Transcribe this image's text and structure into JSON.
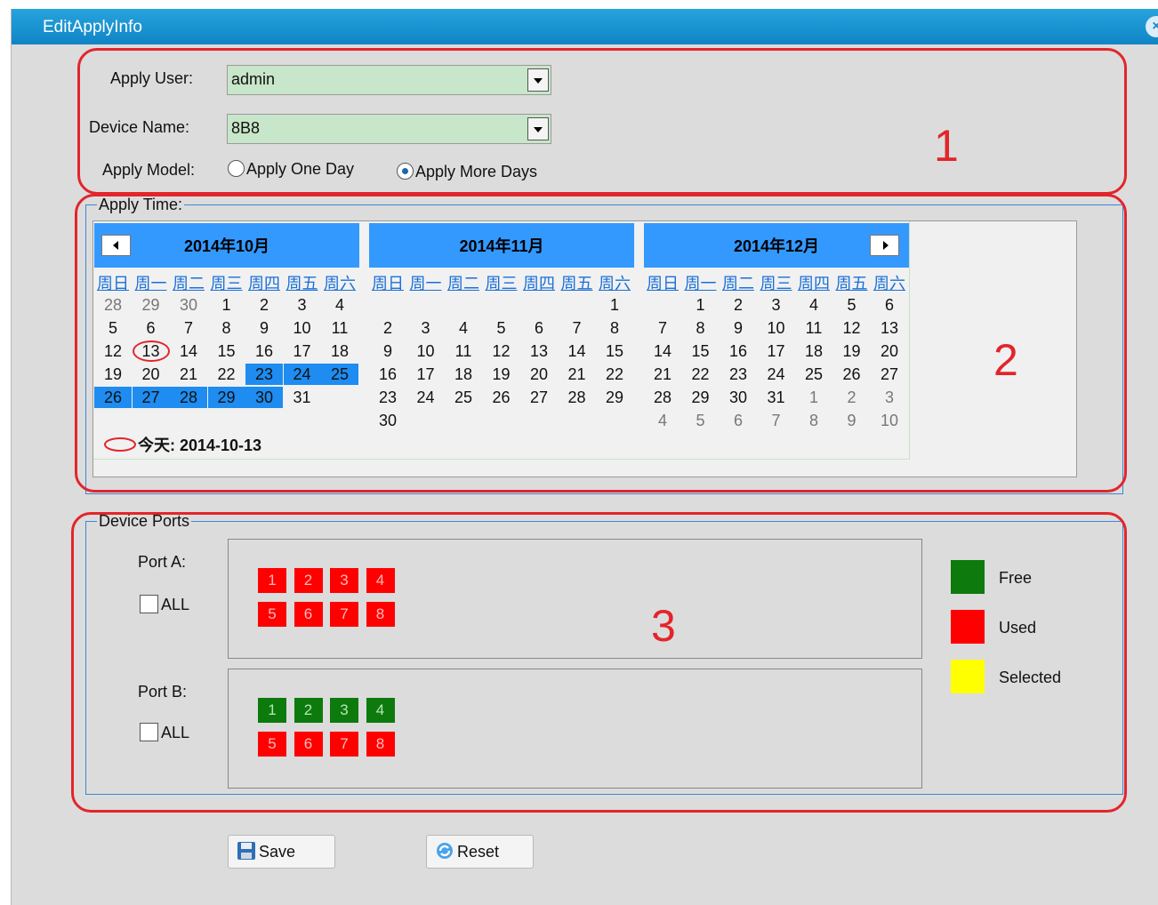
{
  "window": {
    "title": "EditApplyInfo",
    "close_glyph": "×"
  },
  "form": {
    "apply_user_label": "Apply User:",
    "apply_user_value": "admin",
    "device_name_label": "Device Name:",
    "device_name_value": "8B8",
    "apply_model_label": "Apply Model:",
    "options": [
      {
        "label": "Apply One Day",
        "selected": false
      },
      {
        "label": "Apply More Days",
        "selected": true
      }
    ]
  },
  "apply_time": {
    "legend": "Apply Time:",
    "weekdays": [
      "周日",
      "周一",
      "周二",
      "周三",
      "周四",
      "周五",
      "周六"
    ],
    "months": [
      {
        "title": "2014年10月",
        "rows": [
          [
            "28",
            "29",
            "30",
            "1",
            "2",
            "3",
            "4"
          ],
          [
            "5",
            "6",
            "7",
            "8",
            "9",
            "10",
            "11"
          ],
          [
            "12",
            "13",
            "14",
            "15",
            "16",
            "17",
            "18"
          ],
          [
            "19",
            "20",
            "21",
            "22",
            "23",
            "24",
            "25"
          ],
          [
            "26",
            "27",
            "28",
            "29",
            "30",
            "31",
            ""
          ],
          [
            "",
            "",
            "",
            "",
            "",
            "",
            ""
          ]
        ],
        "other_month": [
          [
            0,
            0
          ],
          [
            0,
            1
          ],
          [
            0,
            2
          ]
        ],
        "selected": [
          [
            3,
            4
          ],
          [
            3,
            5
          ],
          [
            3,
            6
          ],
          [
            4,
            0
          ],
          [
            4,
            1
          ],
          [
            4,
            2
          ],
          [
            4,
            3
          ],
          [
            4,
            4
          ]
        ],
        "today": [
          2,
          1
        ]
      },
      {
        "title": "2014年11月",
        "rows": [
          [
            "",
            "",
            "",
            "",
            "",
            "",
            "1"
          ],
          [
            "2",
            "3",
            "4",
            "5",
            "6",
            "7",
            "8"
          ],
          [
            "9",
            "10",
            "11",
            "12",
            "13",
            "14",
            "15"
          ],
          [
            "16",
            "17",
            "18",
            "19",
            "20",
            "21",
            "22"
          ],
          [
            "23",
            "24",
            "25",
            "26",
            "27",
            "28",
            "29"
          ],
          [
            "30",
            "",
            "",
            "",
            "",
            "",
            ""
          ]
        ],
        "other_month": [],
        "selected": []
      },
      {
        "title": "2014年12月",
        "rows": [
          [
            "",
            "1",
            "2",
            "3",
            "4",
            "5",
            "6"
          ],
          [
            "7",
            "8",
            "9",
            "10",
            "11",
            "12",
            "13"
          ],
          [
            "14",
            "15",
            "16",
            "17",
            "18",
            "19",
            "20"
          ],
          [
            "21",
            "22",
            "23",
            "24",
            "25",
            "26",
            "27"
          ],
          [
            "28",
            "29",
            "30",
            "31",
            "1",
            "2",
            "3"
          ],
          [
            "4",
            "5",
            "6",
            "7",
            "8",
            "9",
            "10"
          ]
        ],
        "other_month": [
          [
            4,
            4
          ],
          [
            4,
            5
          ],
          [
            4,
            6
          ],
          [
            5,
            0
          ],
          [
            5,
            1
          ],
          [
            5,
            2
          ],
          [
            5,
            3
          ],
          [
            5,
            4
          ],
          [
            5,
            5
          ],
          [
            5,
            6
          ]
        ],
        "selected": []
      }
    ],
    "today_label": "今天: 2014-10-13"
  },
  "device_ports": {
    "legend": "Device Ports",
    "port_a": {
      "label": "Port A:",
      "all_label": "ALL",
      "ports": [
        {
          "n": "1",
          "status": "used"
        },
        {
          "n": "2",
          "status": "used"
        },
        {
          "n": "3",
          "status": "used"
        },
        {
          "n": "4",
          "status": "used"
        },
        {
          "n": "5",
          "status": "used"
        },
        {
          "n": "6",
          "status": "used"
        },
        {
          "n": "7",
          "status": "used"
        },
        {
          "n": "8",
          "status": "used"
        }
      ]
    },
    "port_b": {
      "label": "Port B:",
      "all_label": "ALL",
      "ports": [
        {
          "n": "1",
          "status": "free"
        },
        {
          "n": "2",
          "status": "free"
        },
        {
          "n": "3",
          "status": "free"
        },
        {
          "n": "4",
          "status": "free"
        },
        {
          "n": "5",
          "status": "used"
        },
        {
          "n": "6",
          "status": "used"
        },
        {
          "n": "7",
          "status": "used"
        },
        {
          "n": "8",
          "status": "used"
        }
      ]
    },
    "legend_items": [
      {
        "label": "Free",
        "color": "#0c7a0c"
      },
      {
        "label": "Used",
        "color": "#ff0000"
      },
      {
        "label": "Selected",
        "color": "#ffff00"
      }
    ]
  },
  "annotations": {
    "n1": "1",
    "n2": "2",
    "n3": "3",
    "color": "#e2252b"
  },
  "buttons": {
    "save_label": "Save",
    "reset_label": "Reset"
  }
}
